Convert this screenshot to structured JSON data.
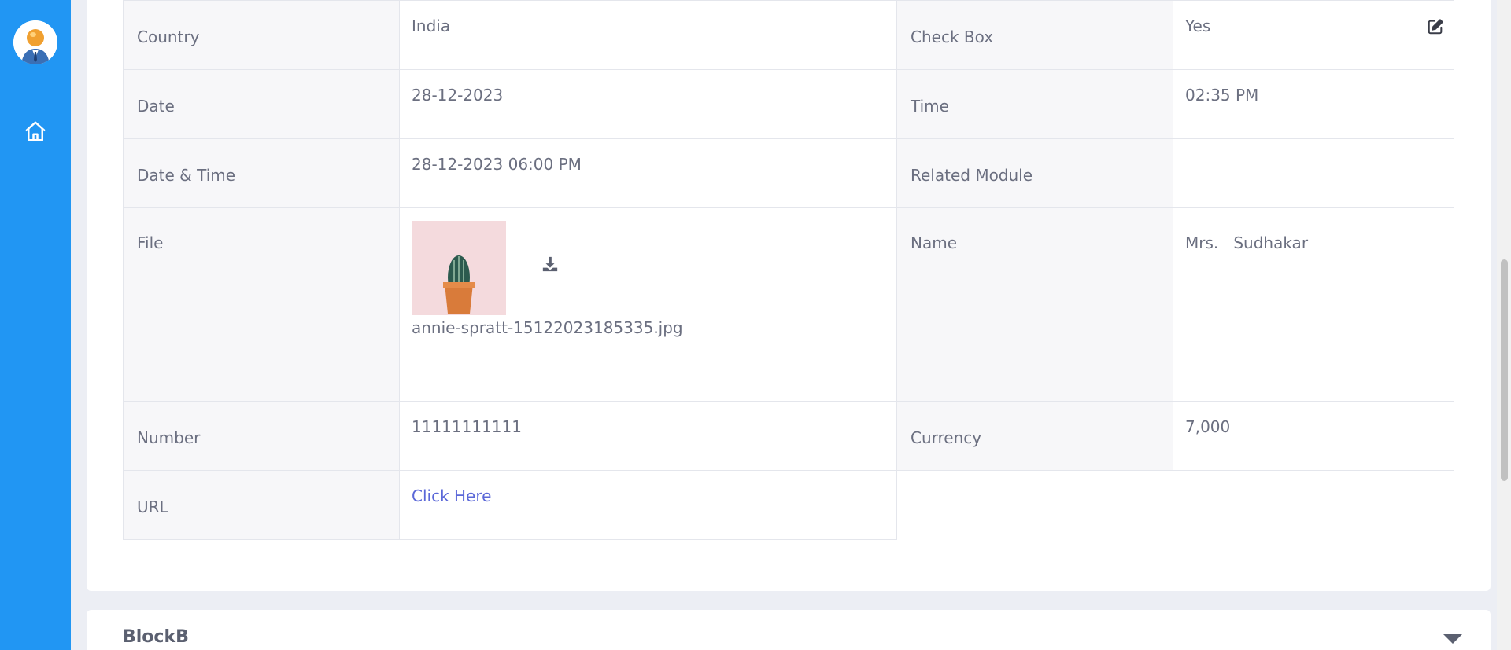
{
  "block": {
    "fields": {
      "country_label": "Country",
      "country_value": "India",
      "checkbox_label": "Check Box",
      "checkbox_value": "Yes",
      "date_label": "Date",
      "date_value": "28-12-2023",
      "time_label": "Time",
      "time_value": "02:35 PM",
      "datetime_label": "Date & Time",
      "datetime_value": "28-12-2023 06:00 PM",
      "related_label": "Related Module",
      "related_value": "",
      "file_label": "File",
      "file_name": "annie-spratt-15122023185335.jpg",
      "name_label": "Name",
      "name_value": "Mrs.   Sudhakar",
      "number_label": "Number",
      "number_value": "11111111111",
      "currency_label": "Currency",
      "currency_value": "7,000",
      "url_label": "URL",
      "url_value": "Click Here"
    }
  },
  "block_b": {
    "title": "BlockB"
  },
  "icons": {
    "home": "home-icon",
    "edit": "edit-icon",
    "download": "download-icon",
    "chevron": "chevron-down-icon"
  },
  "colors": {
    "sidebar": "#2196f3",
    "link": "#5b68d8"
  }
}
